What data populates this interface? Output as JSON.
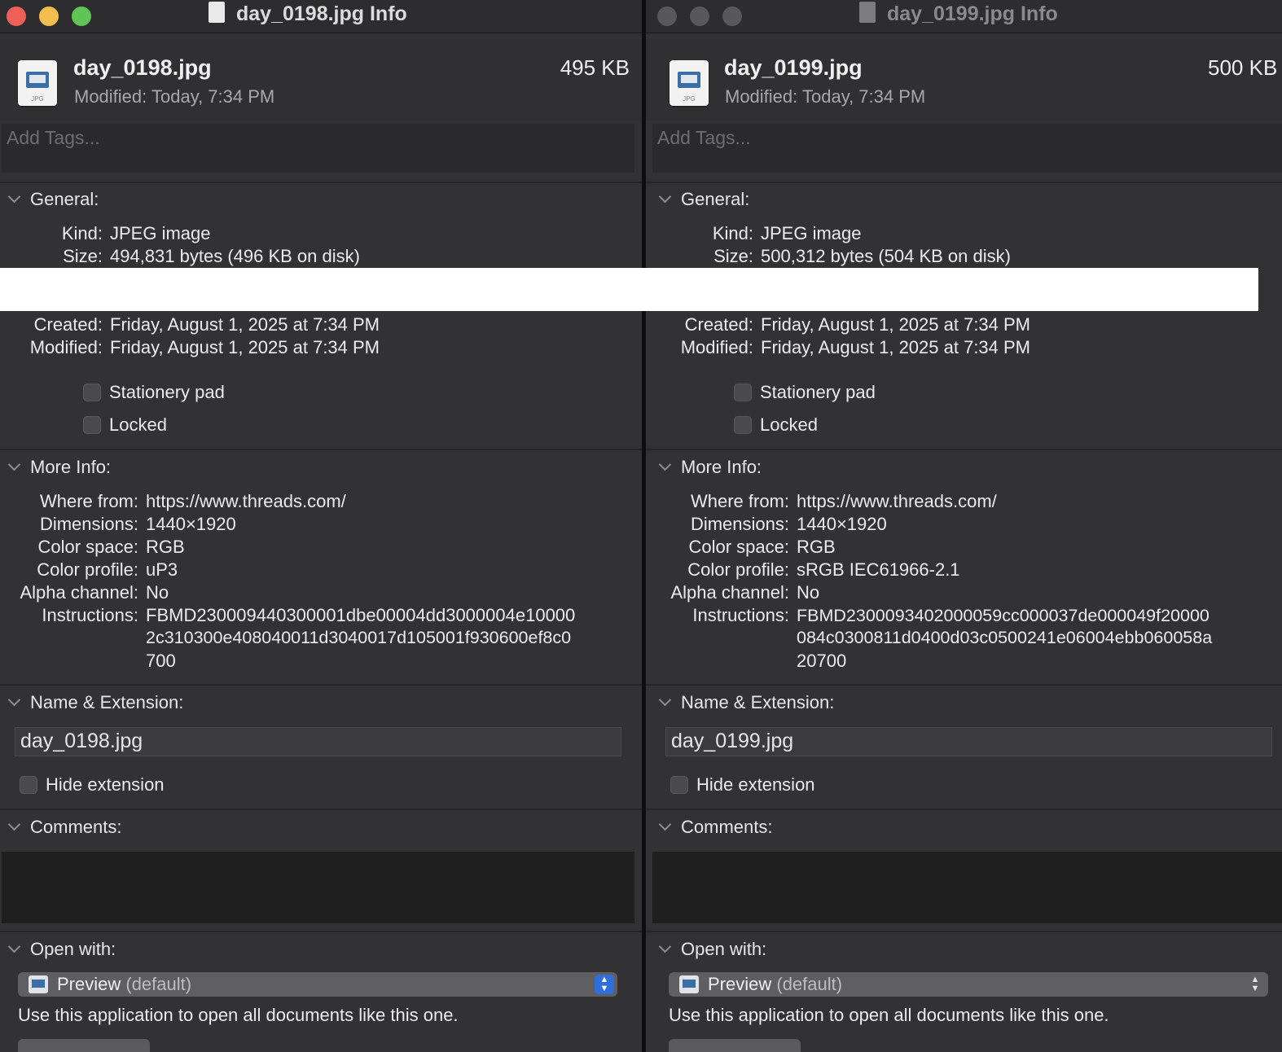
{
  "windows": [
    {
      "title": "day_0198.jpg Info",
      "file_name": "day_0198.jpg",
      "file_size": "495 KB",
      "modified_label": "Modified:",
      "modified_value": "Today, 7:34 PM",
      "tags_placeholder": "Add Tags...",
      "general": {
        "heading": "General:",
        "kind_label": "Kind:",
        "kind_value": "JPEG image",
        "size_label": "Size:",
        "size_value": "494,831 bytes (496 KB on disk)",
        "created_label": "Created:",
        "created_value": "Friday, August 1, 2025 at 7:34 PM",
        "modified_label": "Modified:",
        "modified_value": "Friday, August 1, 2025 at 7:34 PM",
        "stationery_label": "Stationery pad",
        "locked_label": "Locked"
      },
      "more_info": {
        "heading": "More Info:",
        "where_label": "Where from:",
        "where_value": "https://www.threads.com/",
        "dimensions_label": "Dimensions:",
        "dimensions_value": "1440×1920",
        "colorspace_label": "Color space:",
        "colorspace_value": "RGB",
        "profile_label": "Color profile:",
        "profile_value": "uP3",
        "alpha_label": "Alpha channel:",
        "alpha_value": "No",
        "instructions_label": "Instructions:",
        "instructions_lines": [
          "FBMD230009440300001dbe00004dd3000004e10000",
          "2c310300e408040011d3040017d105001f930600ef8c0",
          "700"
        ]
      },
      "name_ext": {
        "heading": "Name & Extension:",
        "value": "day_0198.jpg",
        "hide_ext_label": "Hide extension"
      },
      "comments": {
        "heading": "Comments:"
      },
      "open_with": {
        "heading": "Open with:",
        "app": "Preview",
        "default": "(default)",
        "use_text": "Use this application to open all documents like this one."
      }
    },
    {
      "title": "day_0199.jpg Info",
      "file_name": "day_0199.jpg",
      "file_size": "500 KB",
      "modified_label": "Modified:",
      "modified_value": "Today, 7:34 PM",
      "tags_placeholder": "Add Tags...",
      "general": {
        "heading": "General:",
        "kind_label": "Kind:",
        "kind_value": "JPEG image",
        "size_label": "Size:",
        "size_value": "500,312 bytes (504 KB on disk)",
        "created_label": "Created:",
        "created_value": "Friday, August 1, 2025 at 7:34 PM",
        "modified_label": "Modified:",
        "modified_value": "Friday, August 1, 2025 at 7:34 PM",
        "stationery_label": "Stationery pad",
        "locked_label": "Locked"
      },
      "more_info": {
        "heading": "More Info:",
        "where_label": "Where from:",
        "where_value": "https://www.threads.com/",
        "dimensions_label": "Dimensions:",
        "dimensions_value": "1440×1920",
        "colorspace_label": "Color space:",
        "colorspace_value": "RGB",
        "profile_label": "Color profile:",
        "profile_value": "sRGB IEC61966-2.1",
        "alpha_label": "Alpha channel:",
        "alpha_value": "No",
        "instructions_label": "Instructions:",
        "instructions_lines": [
          "FBMD2300093402000059cc000037de000049f20000",
          "084c0300811d0400d03c0500241e06004ebb060058a",
          "20700"
        ]
      },
      "name_ext": {
        "heading": "Name & Extension:",
        "value": "day_0199.jpg",
        "hide_ext_label": "Hide extension"
      },
      "comments": {
        "heading": "Comments:"
      },
      "open_with": {
        "heading": "Open with:",
        "app": "Preview",
        "default": "(default)",
        "use_text": "Use this application to open all documents like this one."
      }
    }
  ],
  "colors": {
    "close": "#ee5f57",
    "minimize": "#f4bd4f",
    "zoom": "#5fc454",
    "accent": "#2f6fdc"
  }
}
